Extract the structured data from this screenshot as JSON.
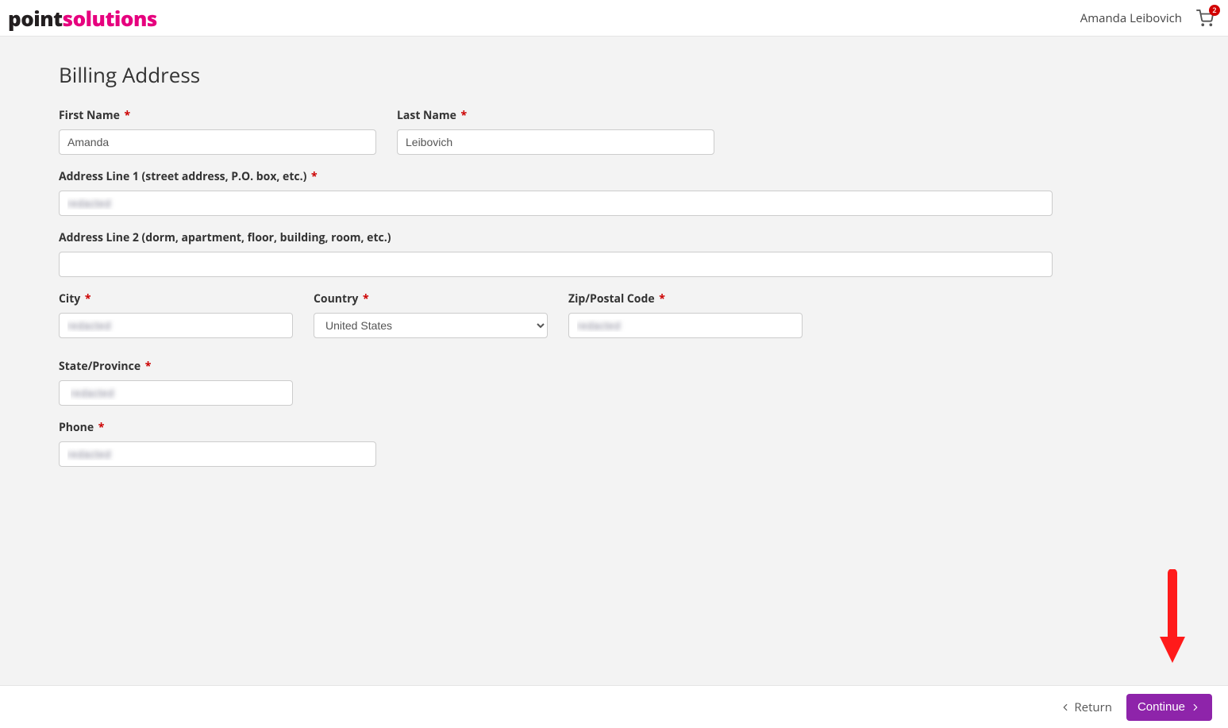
{
  "header": {
    "logo_part1": "point",
    "logo_part2": "solutions",
    "user_name": "Amanda Leibovich",
    "cart_count": "2"
  },
  "page": {
    "title": "Billing Address"
  },
  "form": {
    "first_name": {
      "label": "First Name",
      "value": "Amanda",
      "required": true
    },
    "last_name": {
      "label": "Last Name",
      "value": "Leibovich",
      "required": true
    },
    "address1": {
      "label": "Address Line 1 (street address, P.O. box, etc.)",
      "value": "redacted",
      "required": true
    },
    "address2": {
      "label": "Address Line 2 (dorm, apartment, floor, building, room, etc.)",
      "value": "",
      "required": false
    },
    "city": {
      "label": "City",
      "value": "redacted",
      "required": true
    },
    "country": {
      "label": "Country",
      "value": "United States",
      "required": true
    },
    "zip": {
      "label": "Zip/Postal Code",
      "value": "redacted",
      "required": true
    },
    "state": {
      "label": "State/Province",
      "value": "redacted",
      "required": true
    },
    "phone": {
      "label": "Phone",
      "value": "redacted",
      "required": true
    }
  },
  "footer": {
    "return_label": "Return",
    "continue_label": "Continue"
  }
}
